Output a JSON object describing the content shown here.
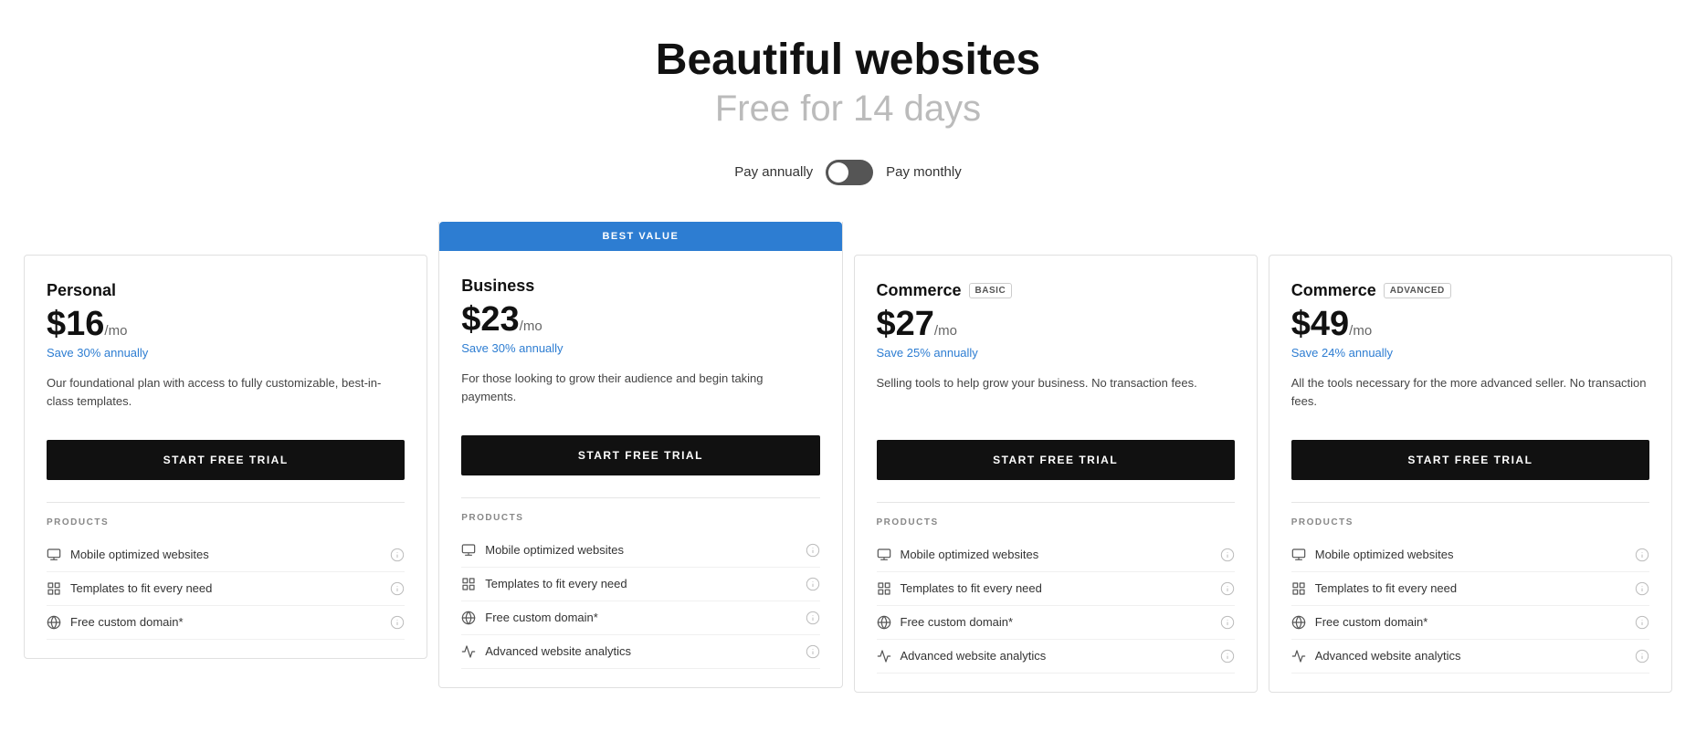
{
  "hero": {
    "title": "Beautiful websites",
    "subtitle": "Free for 14 days"
  },
  "billing": {
    "annual_label": "Pay annually",
    "monthly_label": "Pay monthly"
  },
  "plans": [
    {
      "id": "personal",
      "name": "Personal",
      "badge": null,
      "best_value": false,
      "price": "$16",
      "per": "/mo",
      "savings": "Save 30% annually",
      "description": "Our foundational plan with access to fully customizable, best-in-class templates.",
      "cta": "START FREE TRIAL",
      "features": [
        {
          "icon": "monitor-icon",
          "label": "Mobile optimized websites"
        },
        {
          "icon": "grid-icon",
          "label": "Templates to fit every need"
        },
        {
          "icon": "globe-icon",
          "label": "Free custom domain*"
        }
      ]
    },
    {
      "id": "business",
      "name": "Business",
      "badge": null,
      "best_value": true,
      "best_value_label": "BEST VALUE",
      "price": "$23",
      "per": "/mo",
      "savings": "Save 30% annually",
      "description": "For those looking to grow their audience and begin taking payments.",
      "cta": "START FREE TRIAL",
      "features": [
        {
          "icon": "monitor-icon",
          "label": "Mobile optimized websites"
        },
        {
          "icon": "grid-icon",
          "label": "Templates to fit every need"
        },
        {
          "icon": "globe-icon",
          "label": "Free custom domain*"
        },
        {
          "icon": "analytics-icon",
          "label": "Advanced website analytics"
        }
      ]
    },
    {
      "id": "commerce-basic",
      "name": "Commerce",
      "badge": "BASIC",
      "best_value": false,
      "price": "$27",
      "per": "/mo",
      "savings": "Save 25% annually",
      "description": "Selling tools to help grow your business. No transaction fees.",
      "cta": "START FREE TRIAL",
      "features": [
        {
          "icon": "monitor-icon",
          "label": "Mobile optimized websites"
        },
        {
          "icon": "grid-icon",
          "label": "Templates to fit every need"
        },
        {
          "icon": "globe-icon",
          "label": "Free custom domain*"
        },
        {
          "icon": "analytics-icon",
          "label": "Advanced website analytics"
        }
      ]
    },
    {
      "id": "commerce-advanced",
      "name": "Commerce",
      "badge": "ADVANCED",
      "best_value": false,
      "price": "$49",
      "per": "/mo",
      "savings": "Save 24% annually",
      "description": "All the tools necessary for the more advanced seller. No transaction fees.",
      "cta": "START FREE TRIAL",
      "features": [
        {
          "icon": "monitor-icon",
          "label": "Mobile optimized websites"
        },
        {
          "icon": "grid-icon",
          "label": "Templates to fit every need"
        },
        {
          "icon": "globe-icon",
          "label": "Free custom domain*"
        },
        {
          "icon": "analytics-icon",
          "label": "Advanced website analytics"
        }
      ]
    }
  ],
  "products_section_label": "PRODUCTS"
}
